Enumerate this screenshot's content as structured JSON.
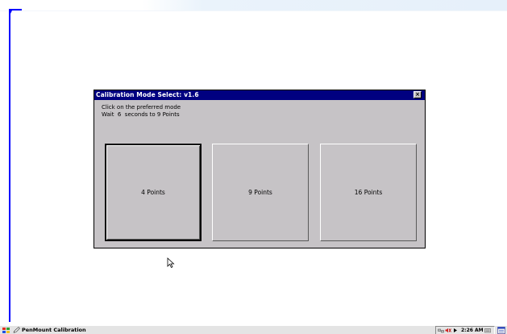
{
  "dialog": {
    "title": "Calibration Mode Select: v1.6",
    "close_label": "×",
    "instruction_line1": "Click on the preferred mode",
    "instruction_line2": "Wait  6  seconds to 9 Points",
    "buttons": [
      {
        "label": "4 Points",
        "focused": true
      },
      {
        "label": "9 Points",
        "focused": false
      },
      {
        "label": "16 Points",
        "focused": false
      }
    ]
  },
  "taskbar": {
    "task_label": "PenMount Calibration",
    "clock": "2:26 AM",
    "icons": [
      "start-icon",
      "pen-icon",
      "network-icon",
      "volume-icon",
      "arrow-icon",
      "keyboard-icon",
      "desktop-icon"
    ]
  },
  "colors": {
    "titlebar": "#000080",
    "dialog_face": "#c6c3c6",
    "calibration_marker": "#0000ff",
    "background": "#ffffff"
  }
}
